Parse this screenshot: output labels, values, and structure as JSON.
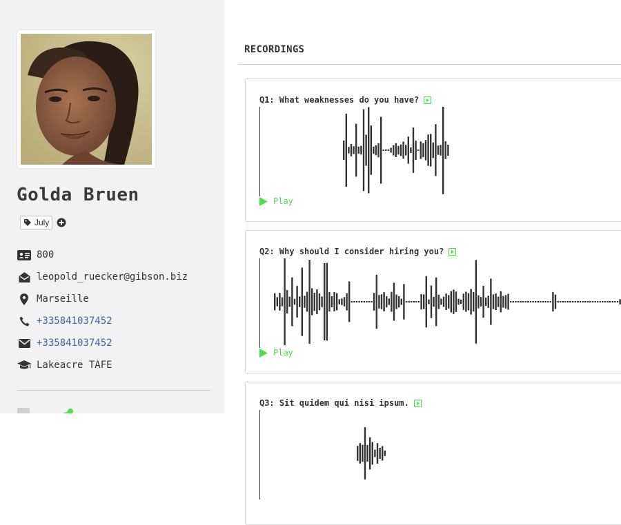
{
  "profile": {
    "name": "Golda Bruen",
    "tag": "July",
    "info": [
      {
        "icon": "id-card-icon",
        "text": "800",
        "link": false
      },
      {
        "icon": "envelope-open-icon",
        "text": "leopold_ruecker@gibson.biz",
        "link": false
      },
      {
        "icon": "map-marker-icon",
        "text": "Marseille",
        "link": false
      },
      {
        "icon": "phone-icon",
        "text": "+335841037452",
        "link": true
      },
      {
        "icon": "envelope-icon",
        "text": "+335841037452",
        "link": true
      },
      {
        "icon": "graduation-cap-icon",
        "text": "Lakeacre TAFE",
        "link": false
      }
    ]
  },
  "recordings": {
    "title": "RECORDINGS",
    "play_label": "Play",
    "items": [
      {
        "question": "Q1: What weaknesses do you have?"
      },
      {
        "question": "Q2: Why should I consider hiring you?"
      },
      {
        "question": "Q3: Sit quidem qui nisi ipsum."
      }
    ]
  },
  "colors": {
    "accent_green": "#4be04b",
    "link_blue": "#3f63a8",
    "sidebar_bg": "#f2f2f2",
    "waveform": "#333333"
  }
}
